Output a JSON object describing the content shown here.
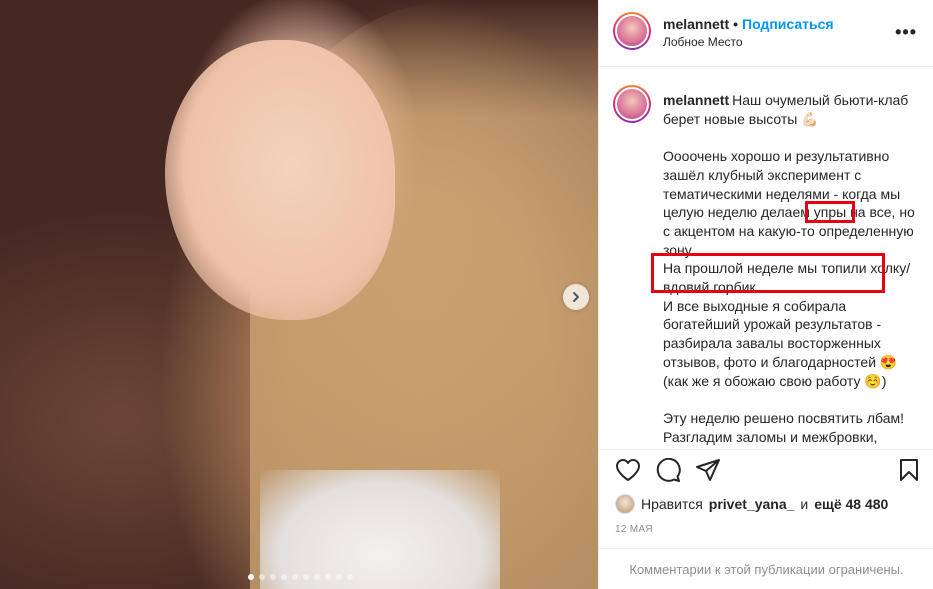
{
  "post": {
    "username": "melannett",
    "separator": "•",
    "follow_label": "Подписаться",
    "location": "Лобное Место",
    "more_label": "•••",
    "caption_username": "melannett",
    "caption_text": "Наш очумелый бьюти-клаб берет новые высоты 💪🏻\n\nОооочень хорошо и результативно зашёл клубный эксперимент с тематическими неделями - когда мы целую неделю делаем упры на все, но с акцентом на какую-то определенную зону.\nНа прошлой неделе мы топили холку/вдовий горбик.\nИ все выходные я собирала богатейший урожай результатов - разбирала завалы восторженных отзывов, фото и благодарностей 😍\n(как же я обожаю свою работу ☺️)\n\nЭту неделю решено посвятить лбам! Разгладим заломы и межбровки, сделаем его ровным и гладким"
  },
  "actions": {
    "like_icon": "heart-icon",
    "comment_icon": "comment-icon",
    "share_icon": "share-icon",
    "save_icon": "bookmark-icon"
  },
  "likes": {
    "prefix": "Нравится",
    "user": "privet_yana_",
    "middle": "и",
    "others": "ещё 48 480"
  },
  "date": "12 МАЯ",
  "comments_restricted": "Комментарии к этой публикации ограничены.",
  "carousel": {
    "slides": 10,
    "active_index": 0
  },
  "highlight_color": "#e60012",
  "accent_color": "#0095f6"
}
